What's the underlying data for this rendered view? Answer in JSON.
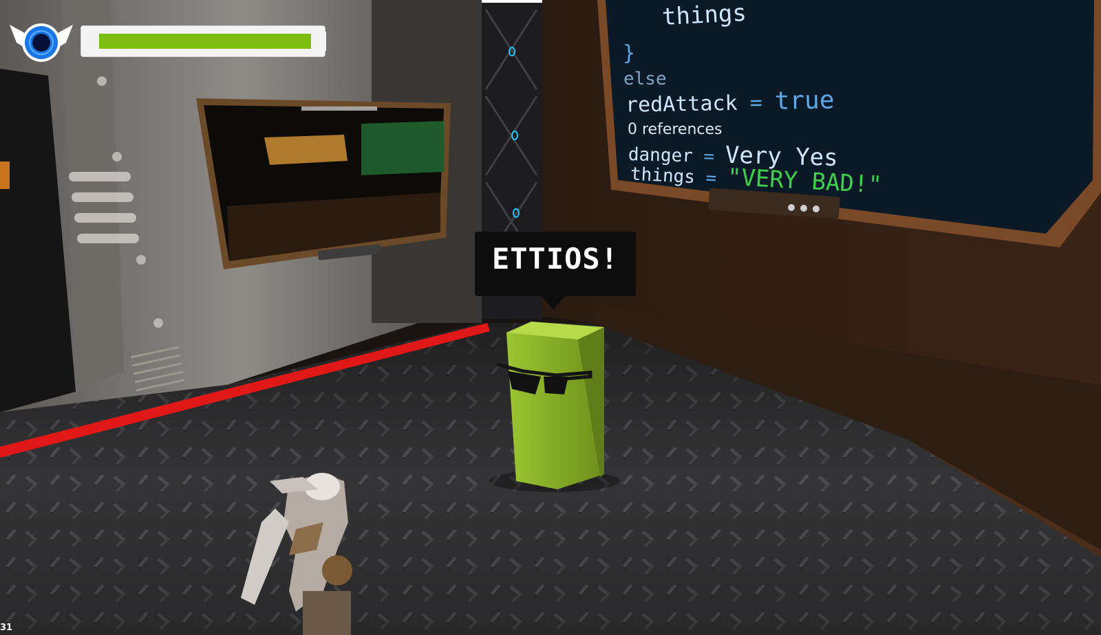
{
  "hud": {
    "emblem_icon": "winged-eye-icon",
    "health_fraction": 0.97,
    "health_color": "#7dbd10"
  },
  "monitor": {
    "lines": {
      "things_top": "things",
      "brace_close": "}",
      "else_kw": "else",
      "red_attack_name": "redAttack",
      "red_attack_eq": " = ",
      "red_attack_val": "true",
      "references": "0 references",
      "danger_name": "danger",
      "danger_eq": " = ",
      "danger_val": "Very Yes",
      "things_name": "things",
      "things_eq": " = ",
      "things_val": "\"VERY BAD!\""
    }
  },
  "npc": {
    "speech": "ETTIOS!",
    "body_color": "#8cb32a"
  },
  "overlay": {
    "fps": "31"
  }
}
